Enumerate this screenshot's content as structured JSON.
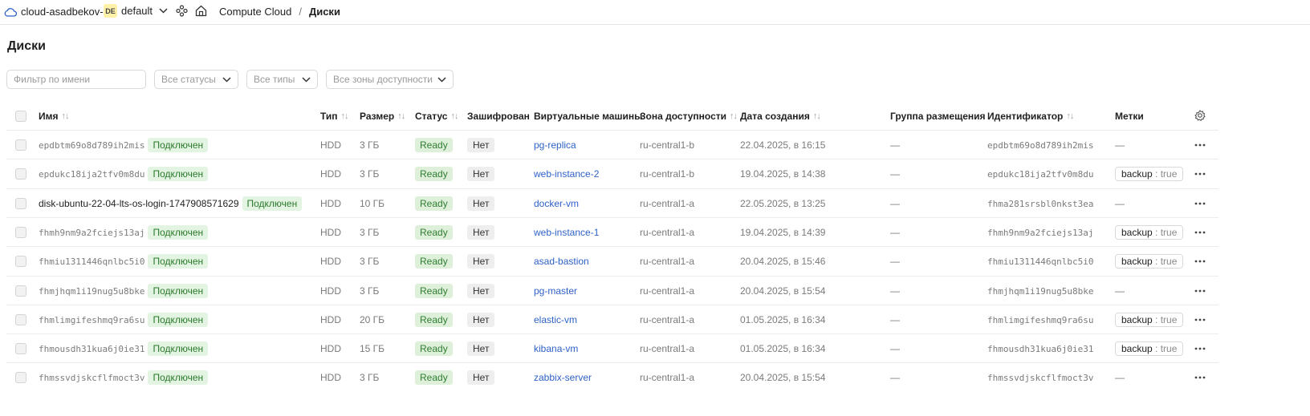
{
  "topbar": {
    "cloud": "cloud-asadbekov-a",
    "folder_badge": "DE",
    "folder": "default",
    "breadcrumb": [
      "Compute Cloud",
      "Диски"
    ],
    "separator": "/"
  },
  "page": {
    "title": "Диски"
  },
  "filters": {
    "name_placeholder": "Фильтр по имени",
    "status": "Все статусы",
    "type": "Все типы",
    "zone": "Все зоны доступности"
  },
  "columns": {
    "name": "Имя",
    "type": "Тип",
    "size": "Размер",
    "status": "Статус",
    "encrypted": "Зашифрован",
    "vms": "Виртуальные машины",
    "zone": "Зона доступности",
    "created": "Дата создания",
    "placement": "Группа размещения",
    "id": "Идентификатор",
    "labels": "Метки"
  },
  "sort_glyph": "↑↓",
  "rows": [
    {
      "name": "epdbtm69o8d789ih2mis",
      "mono": true,
      "attached": "Подключен",
      "type": "HDD",
      "size": "3 ГБ",
      "status": "Ready",
      "encrypted": "Нет",
      "vm": "pg-replica",
      "zone": "ru-central1-b",
      "created": "22.04.2025, в 16:15",
      "placement": "—",
      "id": "epdbtm69o8d789ih2mis",
      "label": null,
      "label_empty": "—"
    },
    {
      "name": "epdukc18ija2tfv0m8du",
      "mono": true,
      "attached": "Подключен",
      "type": "HDD",
      "size": "3 ГБ",
      "status": "Ready",
      "encrypted": "Нет",
      "vm": "web-instance-2",
      "zone": "ru-central1-b",
      "created": "19.04.2025, в 14:38",
      "placement": "—",
      "id": "epdukc18ija2tfv0m8du",
      "label": {
        "key": "backup",
        "sep": " : ",
        "value": "true"
      },
      "label_empty": ""
    },
    {
      "name": "disk-ubuntu-22-04-lts-os-login-1747908571629",
      "mono": false,
      "attached": "Подключен",
      "type": "HDD",
      "size": "10 ГБ",
      "status": "Ready",
      "encrypted": "Нет",
      "vm": "docker-vm",
      "zone": "ru-central1-a",
      "created": "22.05.2025, в 13:25",
      "placement": "—",
      "id": "fhma281srsbl0nkst3ea",
      "label": null,
      "label_empty": "—"
    },
    {
      "name": "fhmh9nm9a2fciejs13aj",
      "mono": true,
      "attached": "Подключен",
      "type": "HDD",
      "size": "3 ГБ",
      "status": "Ready",
      "encrypted": "Нет",
      "vm": "web-instance-1",
      "zone": "ru-central1-a",
      "created": "19.04.2025, в 14:39",
      "placement": "—",
      "id": "fhmh9nm9a2fciejs13aj",
      "label": {
        "key": "backup",
        "sep": " : ",
        "value": "true"
      },
      "label_empty": ""
    },
    {
      "name": "fhmiu1311446qnlbc5i0",
      "mono": true,
      "attached": "Подключен",
      "type": "HDD",
      "size": "3 ГБ",
      "status": "Ready",
      "encrypted": "Нет",
      "vm": "asad-bastion",
      "zone": "ru-central1-a",
      "created": "20.04.2025, в 15:46",
      "placement": "—",
      "id": "fhmiu1311446qnlbc5i0",
      "label": {
        "key": "backup",
        "sep": " : ",
        "value": "true"
      },
      "label_empty": ""
    },
    {
      "name": "fhmjhqm1i19nug5u8bke",
      "mono": true,
      "attached": "Подключен",
      "type": "HDD",
      "size": "3 ГБ",
      "status": "Ready",
      "encrypted": "Нет",
      "vm": "pg-master",
      "zone": "ru-central1-a",
      "created": "20.04.2025, в 15:54",
      "placement": "—",
      "id": "fhmjhqm1i19nug5u8bke",
      "label": null,
      "label_empty": "—"
    },
    {
      "name": "fhmlimgifeshmq9ra6su",
      "mono": true,
      "attached": "Подключен",
      "type": "HDD",
      "size": "20 ГБ",
      "status": "Ready",
      "encrypted": "Нет",
      "vm": "elastic-vm",
      "zone": "ru-central1-a",
      "created": "01.05.2025, в 16:34",
      "placement": "—",
      "id": "fhmlimgifeshmq9ra6su",
      "label": {
        "key": "backup",
        "sep": " : ",
        "value": "true"
      },
      "label_empty": ""
    },
    {
      "name": "fhmousdh31kua6j0ie31",
      "mono": true,
      "attached": "Подключен",
      "type": "HDD",
      "size": "15 ГБ",
      "status": "Ready",
      "encrypted": "Нет",
      "vm": "kibana-vm",
      "zone": "ru-central1-a",
      "created": "01.05.2025, в 16:34",
      "placement": "—",
      "id": "fhmousdh31kua6j0ie31",
      "label": {
        "key": "backup",
        "sep": " : ",
        "value": "true"
      },
      "label_empty": ""
    },
    {
      "name": "fhmssvdjskcflfmoct3v",
      "mono": true,
      "attached": "Подключен",
      "type": "HDD",
      "size": "3 ГБ",
      "status": "Ready",
      "encrypted": "Нет",
      "vm": "zabbix-server",
      "zone": "ru-central1-a",
      "created": "20.04.2025, в 15:54",
      "placement": "—",
      "id": "fhmssvdjskcflfmoct3v",
      "label": null,
      "label_empty": "—"
    }
  ],
  "colors": {
    "link": "#2f62c7",
    "ready_bg": "#dff0da",
    "attached_bg": "#e3f4e3",
    "badge_bg": "#fff1a8"
  },
  "icons": {
    "cloud": "cloud-icon",
    "chevron": "chevron-down-icon",
    "services": "services-icon",
    "home": "home-icon",
    "settings": "gear-icon",
    "row_menu": "more-icon"
  }
}
